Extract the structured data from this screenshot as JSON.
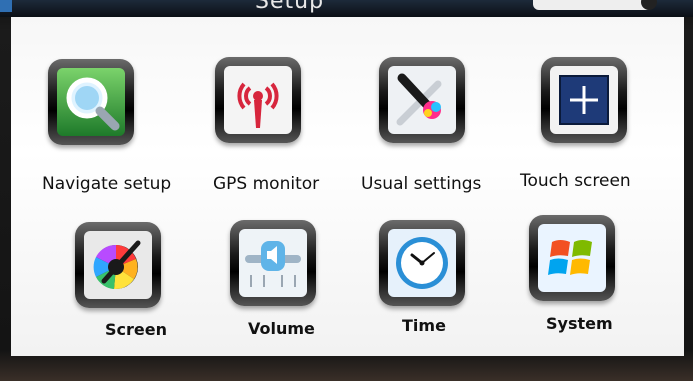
{
  "header": {
    "title": "Setup"
  },
  "menu": {
    "row1": [
      {
        "label": "Navigate setup",
        "icon": "magnifier-icon"
      },
      {
        "label": "GPS monitor",
        "icon": "antenna-icon"
      },
      {
        "label": "Usual settings",
        "icon": "tools-icon"
      },
      {
        "label": "Touch screen",
        "icon": "crosshair-icon"
      }
    ],
    "row2": [
      {
        "label": "Screen",
        "icon": "color-picker-icon"
      },
      {
        "label": "Volume",
        "icon": "speaker-icon"
      },
      {
        "label": "Time",
        "icon": "clock-icon"
      },
      {
        "label": "System",
        "icon": "windows-logo-icon"
      }
    ]
  },
  "colors": {
    "navigate": "#2f8f3a",
    "gps": "#d7263d",
    "touch": "#1e3a78",
    "time": "#2a8fd6"
  }
}
